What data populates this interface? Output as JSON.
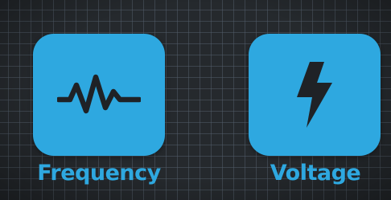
{
  "colors": {
    "background": "#25292d",
    "grid": "#505c68",
    "tile": "#2ea8e0",
    "icon": "#1f2226",
    "label": "#2ea8e0"
  },
  "tiles": [
    {
      "label": "Frequency",
      "icon": "waveform-icon"
    },
    {
      "label": "Voltage",
      "icon": "lightning-bolt-icon"
    }
  ]
}
